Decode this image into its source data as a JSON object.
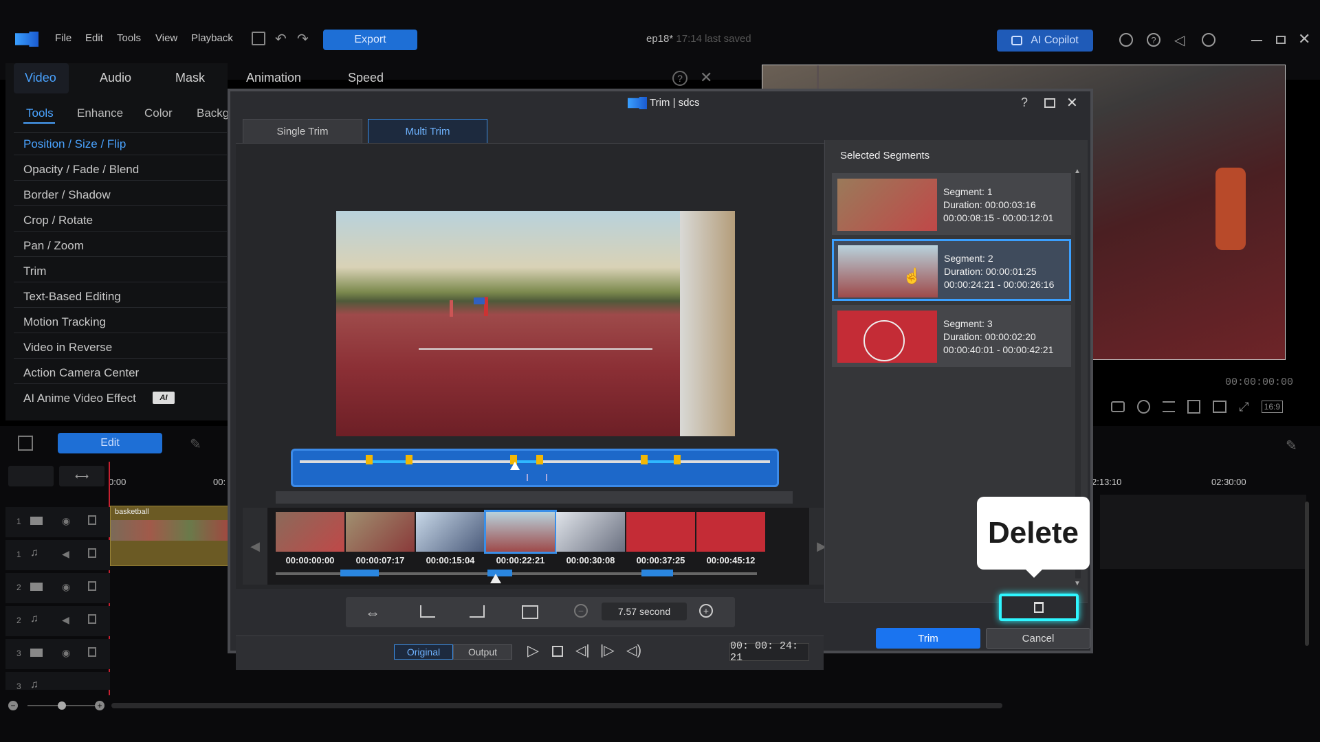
{
  "app": {
    "menu": [
      "File",
      "Edit",
      "Tools",
      "View",
      "Playback"
    ],
    "export_label": "Export",
    "project_name": "ep18*",
    "last_saved": "17:14 last saved",
    "copilot_label": "AI Copilot"
  },
  "left_panel": {
    "main_tabs": [
      "Video",
      "Audio",
      "Mask",
      "Animation",
      "Speed"
    ],
    "sub_tabs": [
      "Tools",
      "Enhance",
      "Color",
      "Backg"
    ],
    "tools": [
      "Position / Size / Flip",
      "Opacity / Fade / Blend",
      "Border / Shadow",
      "Crop / Rotate",
      "Pan / Zoom",
      "Trim",
      "Text-Based Editing",
      "Motion Tracking",
      "Video in Reverse",
      "Action Camera Center",
      "AI Anime Video Effect"
    ],
    "ai_badge": "AI"
  },
  "timeline": {
    "edit_label": "Edit",
    "time_start": "0:00",
    "time_start2": "00:",
    "clip_name": "basketball",
    "track_numbers": [
      "1",
      "1",
      "2",
      "2",
      "3",
      "3"
    ],
    "ruler_right": [
      "2:13:10",
      "02:30:00"
    ]
  },
  "preview": {
    "timecode": "00:00:00:00",
    "aspect": "16:9"
  },
  "dialog": {
    "title": "Trim | sdcs",
    "tabs": [
      "Single Trim",
      "Multi Trim"
    ],
    "thumb_times": [
      "00:00:00:00",
      "00:00:07:17",
      "00:00:15:04",
      "00:00:22:21",
      "00:00:30:08",
      "00:00:37:25",
      "00:00:45:12"
    ],
    "zoom_value": "7.57 second",
    "original_label": "Original",
    "output_label": "Output",
    "current_time": "00: 00: 24: 21",
    "segments_header": "Selected Segments",
    "segments": [
      {
        "name": "Segment: 1",
        "duration": "Duration: 00:00:03:16",
        "range": "00:00:08:15 - 00:00:12:01"
      },
      {
        "name": "Segment: 2",
        "duration": "Duration: 00:00:01:25",
        "range": "00:00:24:21 - 00:00:26:16"
      },
      {
        "name": "Segment: 3",
        "duration": "Duration: 00:00:02:20",
        "range": "00:00:40:01 - 00:00:42:21"
      }
    ],
    "trim_label": "Trim",
    "cancel_label": "Cancel"
  },
  "callout": {
    "text": "Delete"
  }
}
